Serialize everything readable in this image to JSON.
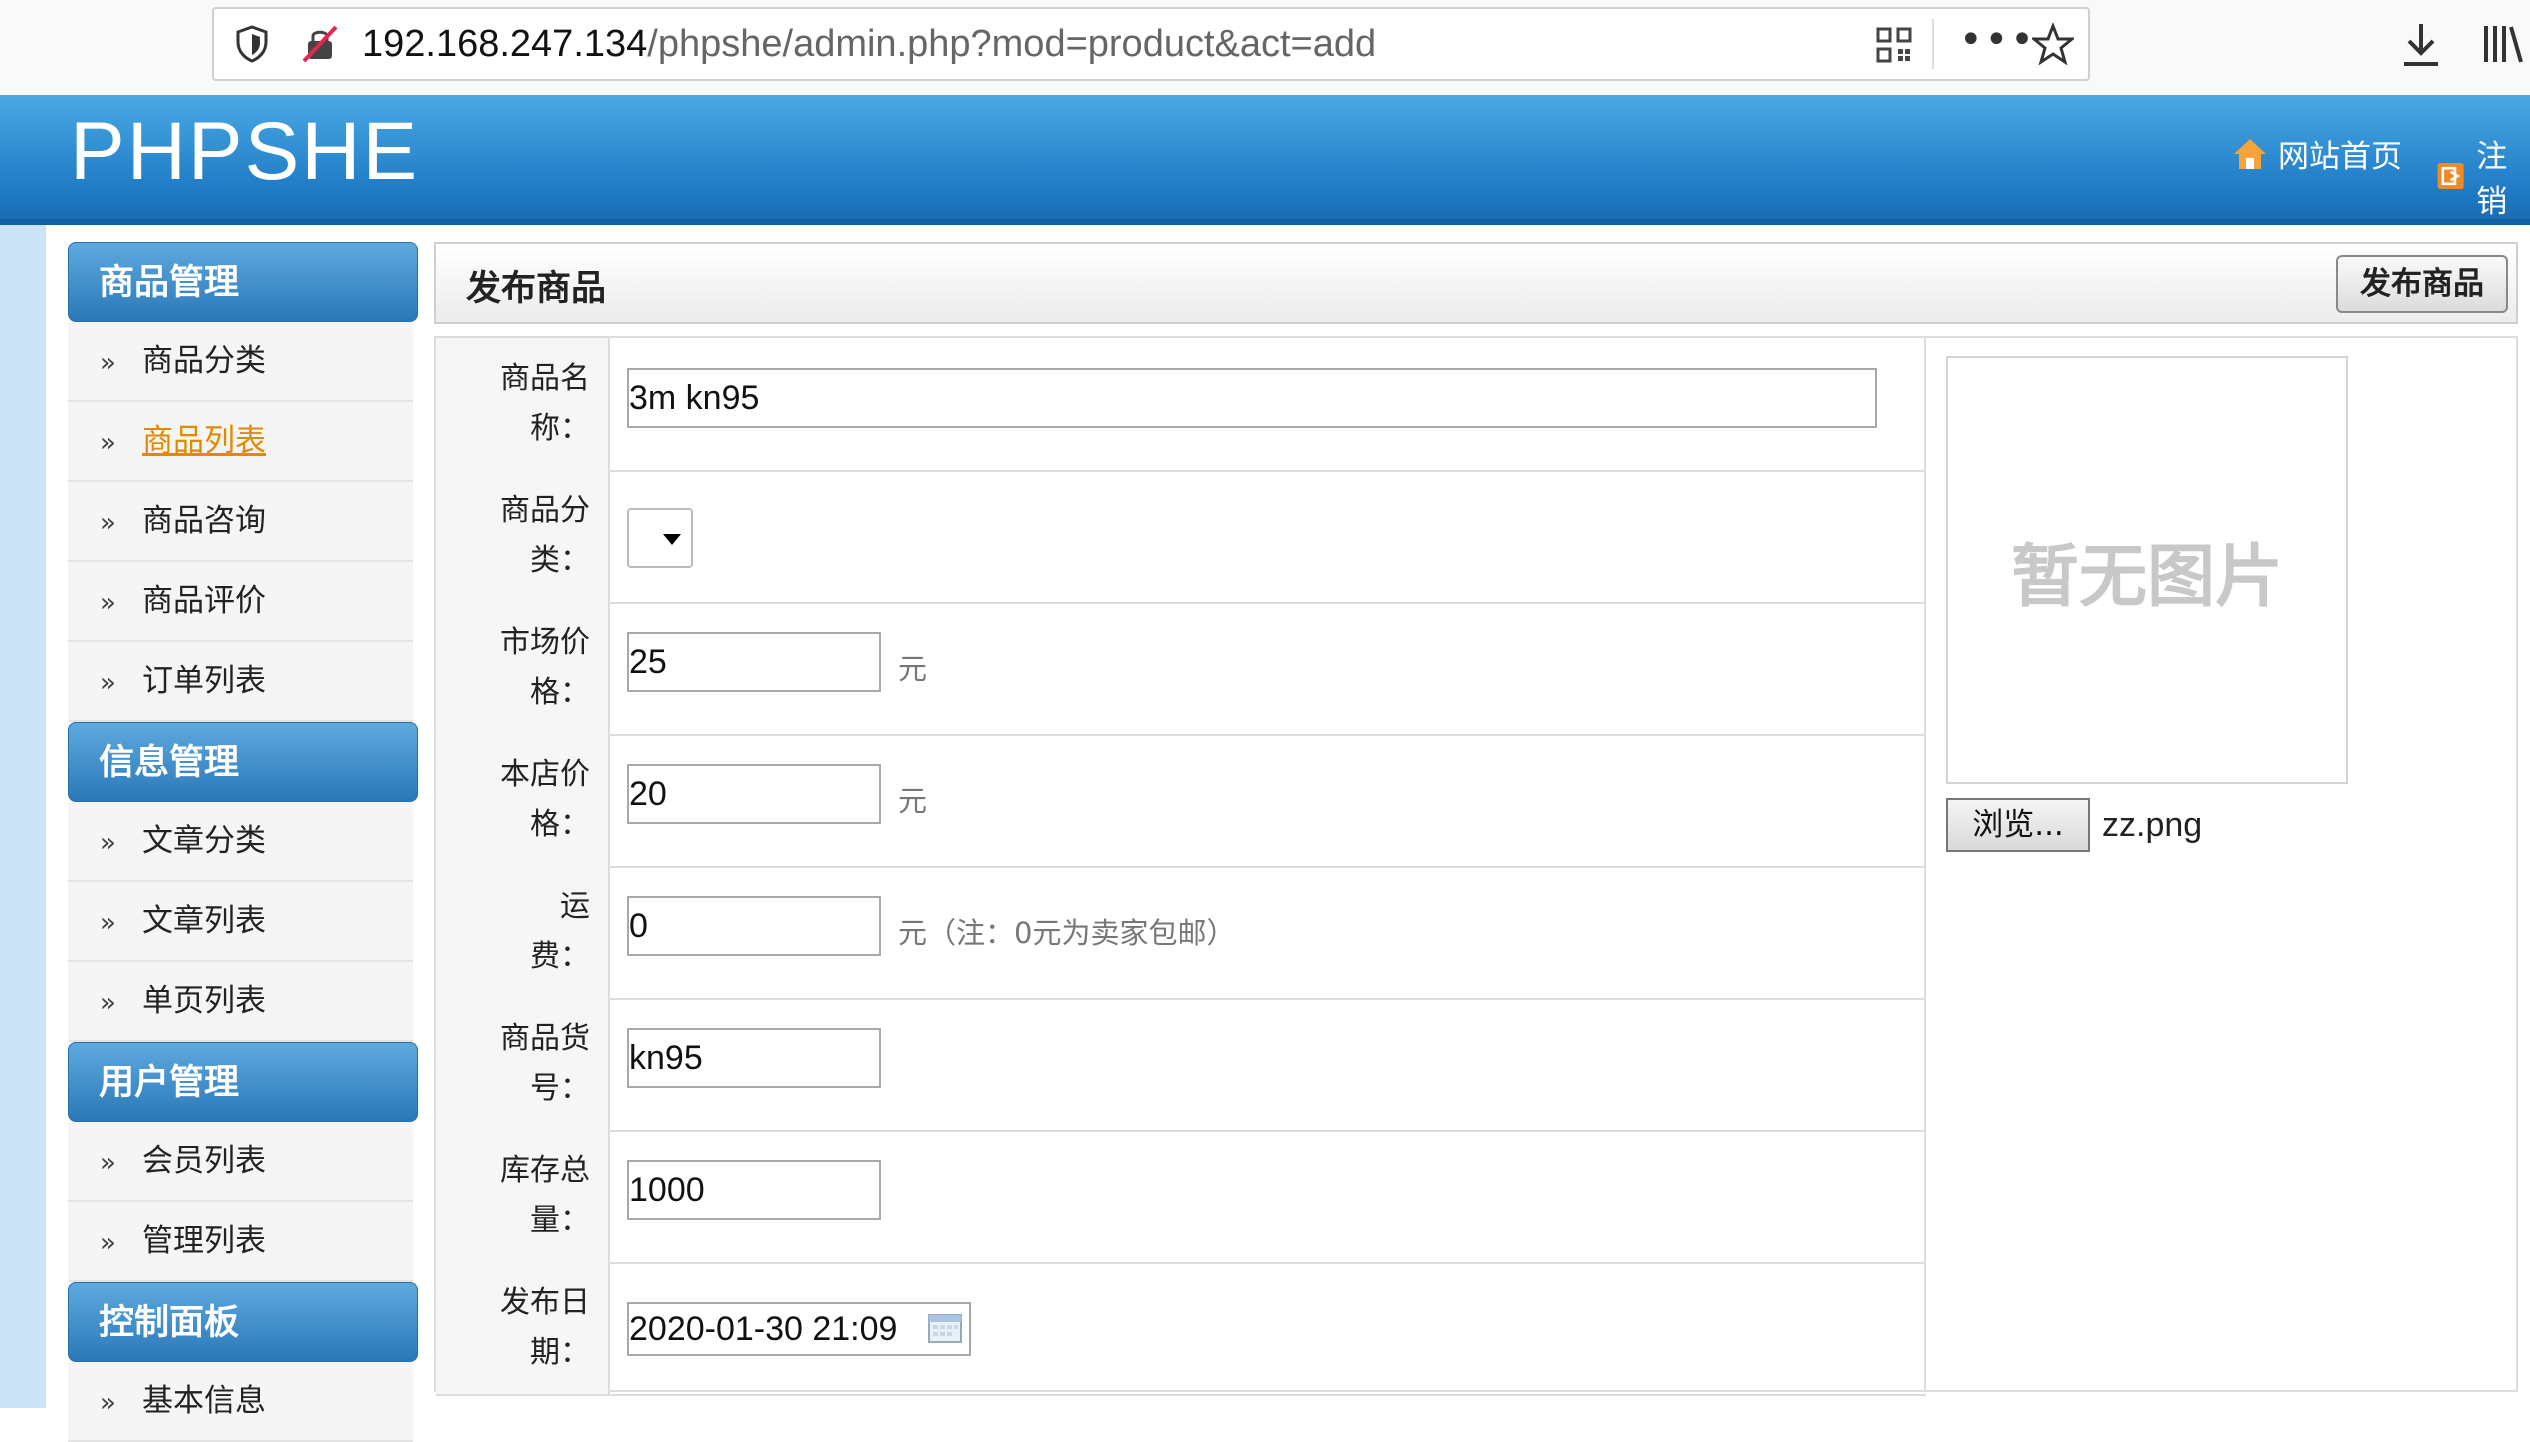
{
  "browser": {
    "url_host": "192.168.247.134",
    "url_path": "/phpshe/admin.php?mod=product&act=add",
    "menu_dots": "•••"
  },
  "header": {
    "logo": "PHPSHE",
    "home_link": "网站首页",
    "logout_link": "注销"
  },
  "sidebar": {
    "groups": [
      {
        "title": "商品管理",
        "items": [
          "商品分类",
          "商品列表",
          "商品咨询",
          "商品评价",
          "订单列表"
        ]
      },
      {
        "title": "信息管理",
        "items": [
          "文章分类",
          "文章列表",
          "单页列表"
        ]
      },
      {
        "title": "用户管理",
        "items": [
          "会员列表",
          "管理列表"
        ]
      },
      {
        "title": "控制面板",
        "items": [
          "基本信息"
        ]
      }
    ],
    "active_item": "商品列表",
    "arrow": "»"
  },
  "panel": {
    "title": "发布商品",
    "publish_button": "发布商品"
  },
  "form": {
    "name": {
      "label_1": "商品名",
      "label_2": "称：",
      "value": "3m kn95"
    },
    "category": {
      "label_1": "商品分",
      "label_2": "类："
    },
    "market_price": {
      "label_1": "市场价",
      "label_2": "格：",
      "value": "25",
      "unit": "元"
    },
    "shop_price": {
      "label_1": "本店价",
      "label_2": "格：",
      "value": "20",
      "unit": "元"
    },
    "shipping": {
      "label_1": "运",
      "label_2": "费：",
      "value": "0",
      "unit": "元（注：0元为卖家包邮）"
    },
    "sku": {
      "label_1": "商品货",
      "label_2": "号：",
      "value": "kn95"
    },
    "stock": {
      "label_1": "库存总",
      "label_2": "量：",
      "value": "1000"
    },
    "date": {
      "label_1": "发布日",
      "label_2": "期：",
      "value": "2020-01-30 21:09"
    }
  },
  "image_panel": {
    "placeholder": "暂无图片",
    "browse_button": "浏览...",
    "file_name": "zz.png"
  },
  "colors": {
    "header_blue": "#1d79c4",
    "active_orange": "#e08a00",
    "strip": "#cbe3f5"
  }
}
